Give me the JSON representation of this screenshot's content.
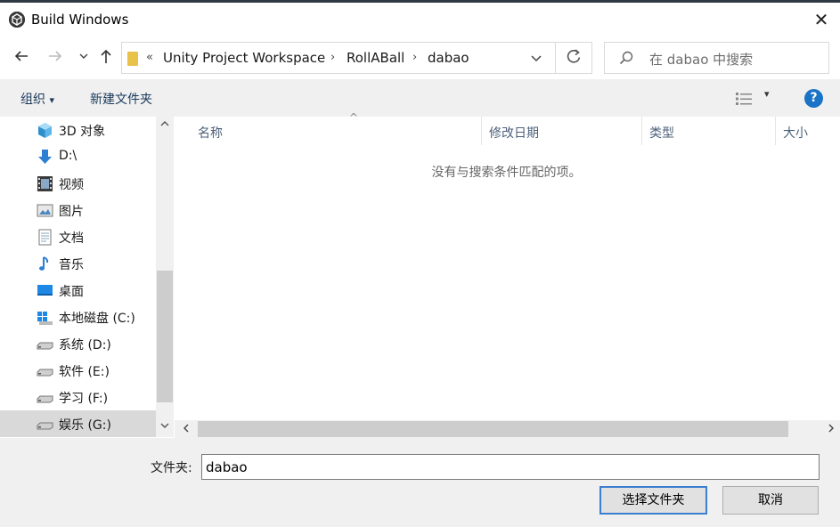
{
  "window": {
    "title": "Build Windows",
    "close_glyph": "✕"
  },
  "nav": {
    "back_icon": "arrow-left-icon",
    "forward_icon": "arrow-right-icon",
    "recent_icon": "chevron-down-icon",
    "up_icon": "arrow-up-icon",
    "overflow": "«",
    "breadcrumbs": [
      "Unity Project Workspace",
      "RollABall",
      "dabao"
    ],
    "search_placeholder": "在 dabao 中搜索"
  },
  "toolbar": {
    "organize": "组织",
    "organize_caret": "▾",
    "new_folder": "新建文件夹",
    "view_caret": "▾",
    "help": "?"
  },
  "sidebar": {
    "items": [
      {
        "label": "3D 对象",
        "icon": "cube-icon"
      },
      {
        "label": "D:\\",
        "icon": "download-arrow-icon"
      },
      {
        "label": "视频",
        "icon": "video-icon"
      },
      {
        "label": "图片",
        "icon": "picture-icon"
      },
      {
        "label": "文档",
        "icon": "document-icon"
      },
      {
        "label": "音乐",
        "icon": "music-icon"
      },
      {
        "label": "桌面",
        "icon": "desktop-icon"
      },
      {
        "label": "本地磁盘 (C:)",
        "icon": "windows-drive-icon"
      },
      {
        "label": "系统 (D:)",
        "icon": "drive-icon"
      },
      {
        "label": "软件 (E:)",
        "icon": "drive-icon"
      },
      {
        "label": "学习 (F:)",
        "icon": "drive-icon"
      },
      {
        "label": "娱乐 (G:)",
        "icon": "drive-icon",
        "selected": true
      }
    ]
  },
  "columns": [
    "名称",
    "修改日期",
    "类型",
    "大小"
  ],
  "empty_message": "没有与搜索条件匹配的项。",
  "footer": {
    "folder_label": "文件夹:",
    "folder_value": "dabao",
    "select_button": "选择文件夹",
    "cancel_button": "取消"
  },
  "colors": {
    "accent": "#1a73c7",
    "selected_bg": "#d9d9d9",
    "toolbar_bg": "#f0f0f0"
  }
}
